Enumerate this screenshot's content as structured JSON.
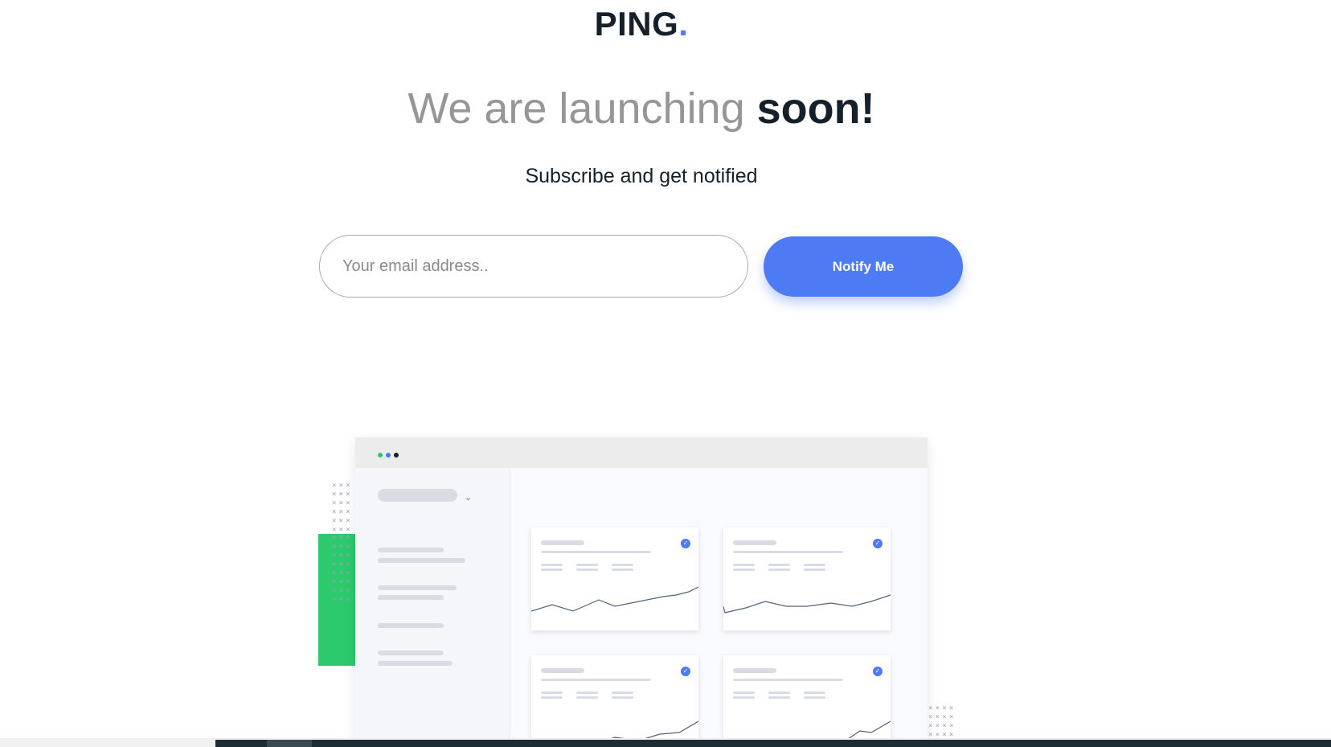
{
  "logo": {
    "text": "PING",
    "dot": "."
  },
  "headline": {
    "light": "We are launching ",
    "bold": "soon!"
  },
  "subtitle": "Subscribe and get notified",
  "form": {
    "email_placeholder": "Your email address..",
    "email_value": "",
    "button_label": "Notify Me"
  },
  "colors": {
    "brand_blue": "#4d7bf3",
    "dark": "#15202a",
    "green": "#2cca6d",
    "gray_text": "#969696"
  },
  "illustration": {
    "window_dots": [
      "#2cca6d",
      "#4d7bf3",
      "#15202a"
    ],
    "chevron_icon": "chevron-down-icon",
    "check_icon": "check-circle-icon"
  }
}
